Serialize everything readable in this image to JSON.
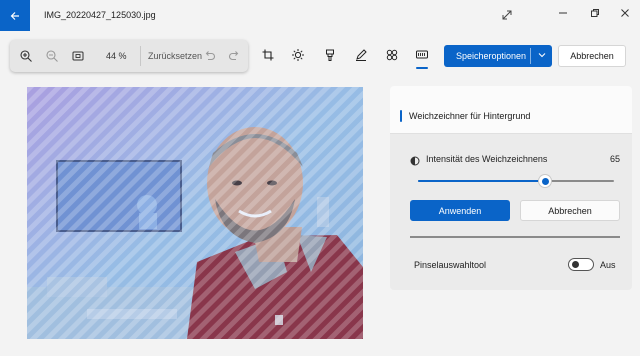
{
  "window": {
    "title": "IMG_20220427_125030.jpg"
  },
  "zoom": {
    "level": "44 %",
    "reset_label": "Zurücksetzen"
  },
  "toolbar": {
    "save_label": "Speicheroptionen",
    "cancel_label": "Abbrechen",
    "active_tool": "background-blur",
    "tools": [
      "crop-icon",
      "adjust-icon",
      "filter-icon",
      "markup-icon",
      "effects-icon",
      "background-blur-icon"
    ]
  },
  "panel": {
    "title": "Weichzeichner für Hintergrund",
    "intensity_label": "Intensität des Weichzeichnens",
    "intensity_value": "65",
    "intensity_fraction": 0.65,
    "apply_label": "Anwenden",
    "cancel_label": "Abbrechen",
    "brush_label": "Pinselauswahltool",
    "brush_state": "Aus"
  },
  "colors": {
    "accent": "#0a64c8",
    "overlay": "#7fa8e0"
  }
}
